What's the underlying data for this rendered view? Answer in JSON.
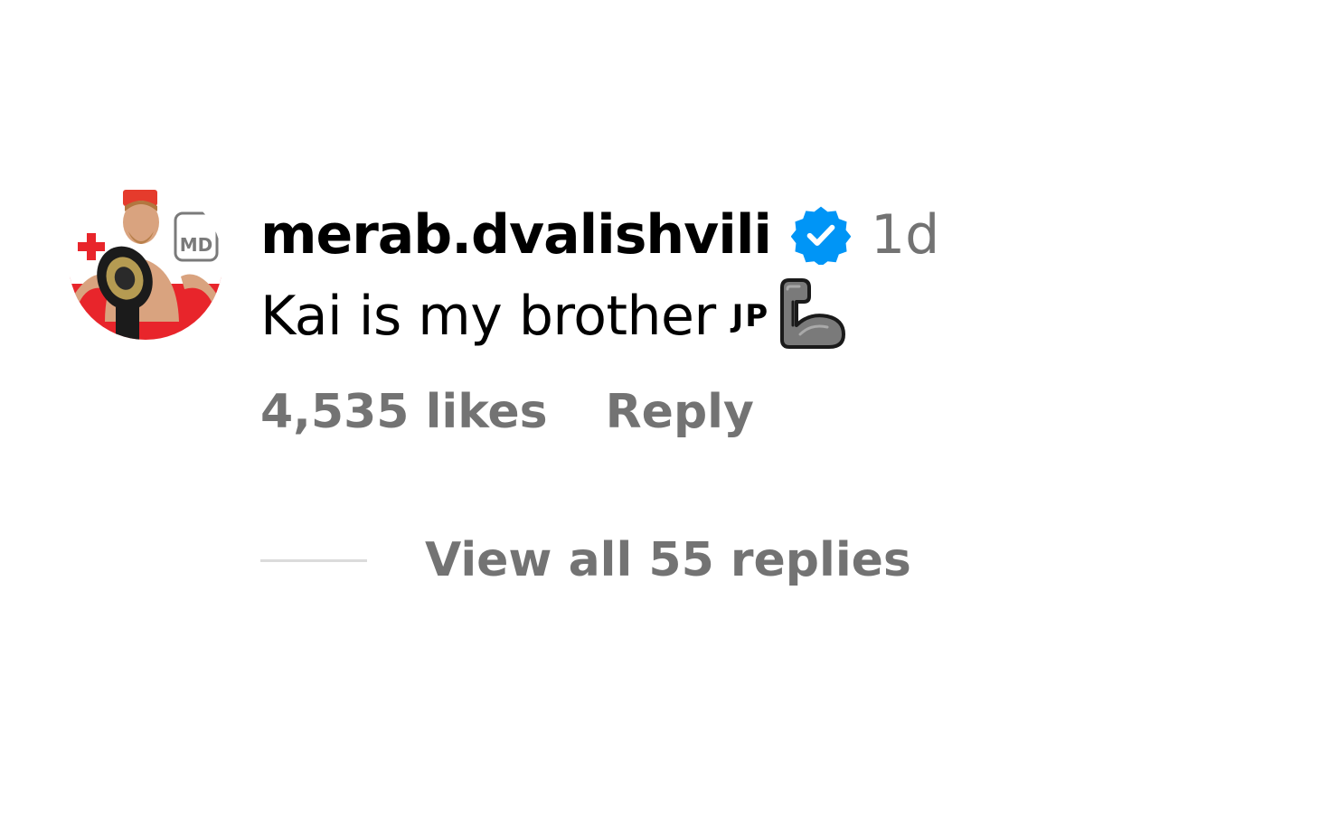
{
  "comment": {
    "username": "merab.dvalishvili",
    "verified": true,
    "time": "1d",
    "text": "Kai is my brother",
    "text_suffix": "JP",
    "emoji_icon": "flexed-biceps-icon",
    "likes": "4,535 likes",
    "reply_label": "Reply",
    "view_replies_label": "View all 55 replies"
  },
  "colors": {
    "verified_blue": "#0095F6",
    "secondary_text": "#737373",
    "divider": "#DBDBDB"
  }
}
